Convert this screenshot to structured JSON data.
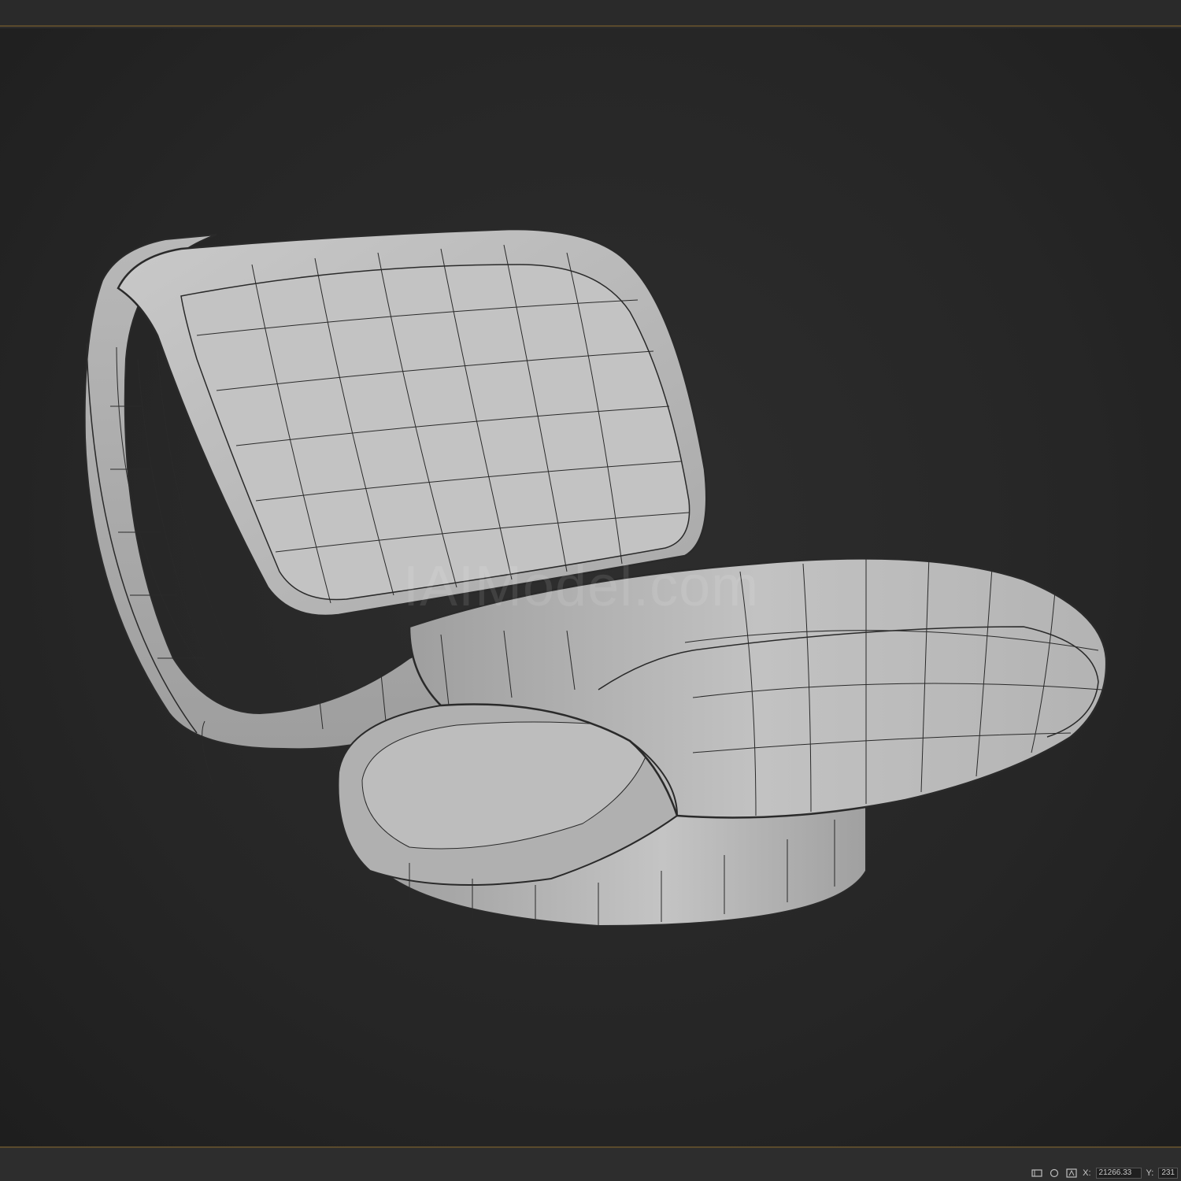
{
  "app": {
    "watermark": "IAIModel.com"
  },
  "status_bar": {
    "x_label": "X:",
    "x_value": "21266.33",
    "y_label": "Y:",
    "y_value": "231"
  },
  "icons": {
    "snap": "snap-icon",
    "lock": "lock-icon",
    "coordinate_mode": "coordinate-mode-icon"
  },
  "colors": {
    "viewport_background": "#262626",
    "accent_border": "#5a4a2c",
    "model_surface": "#b4b4b4",
    "wireframe": "#2a2a2a"
  }
}
